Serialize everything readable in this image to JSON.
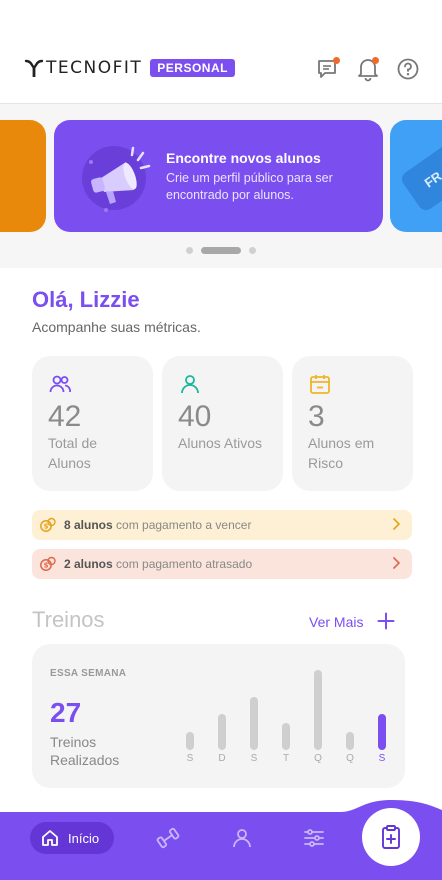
{
  "header": {
    "brand_name": "TECNOFIT",
    "brand_badge": "PERSONAL",
    "icons": [
      "chat-icon",
      "bell-icon",
      "help-icon"
    ]
  },
  "carousel": {
    "active_title": "Encontre novos alunos",
    "active_description": "Crie um perfil público para ser encontrado por alunos.",
    "peek_right_text": "FR",
    "slides_count": 3,
    "active_index": 1
  },
  "greeting": {
    "title": "Olá, Lizzie",
    "subtitle": "Acompanhe suas métricas."
  },
  "metrics": [
    {
      "value": "42",
      "label": "Total de Alunos",
      "icon": "users-icon",
      "color": "#7b4ef0"
    },
    {
      "value": "40",
      "label": "Alunos Ativos",
      "icon": "user-icon",
      "color": "#1bb89a"
    },
    {
      "value": "3",
      "label": "Alunos em Risco",
      "icon": "calendar-minus-icon",
      "color": "#f0b429"
    }
  ],
  "alerts": [
    {
      "count": "8 alunos",
      "text": "com pagamento a vencer",
      "bg": "#fdf0d4",
      "icon_color": "#e8a21c"
    },
    {
      "count": "2 alunos",
      "text": "com pagamento atrasado",
      "bg": "#fbe4dc",
      "icon_color": "#e2664a"
    }
  ],
  "treinos": {
    "title": "Treinos",
    "see_more": "Ver Mais",
    "period_label": "ESSA SEMANA",
    "count": "27",
    "description": "Treinos Realizados",
    "days": [
      {
        "label": "S",
        "value": 2,
        "active": false
      },
      {
        "label": "D",
        "value": 4,
        "active": false
      },
      {
        "label": "S",
        "value": 6,
        "active": false
      },
      {
        "label": "T",
        "value": 3,
        "active": false
      },
      {
        "label": "Q",
        "value": 9,
        "active": false
      },
      {
        "label": "Q",
        "value": 2,
        "active": false
      },
      {
        "label": "S",
        "value": 4,
        "active": true
      }
    ]
  },
  "nav": {
    "home_label": "Início",
    "items": [
      "home-icon",
      "dumbbell-icon",
      "profile-icon",
      "sliders-icon",
      "clipboard-add-icon"
    ]
  },
  "colors": {
    "primary": "#7b4ef0",
    "nav_bg": "#7b4ef0",
    "orange_slide": "#e8890c",
    "blue_slide": "#3fa0f5",
    "notification_dot": "#ee6b2a"
  }
}
